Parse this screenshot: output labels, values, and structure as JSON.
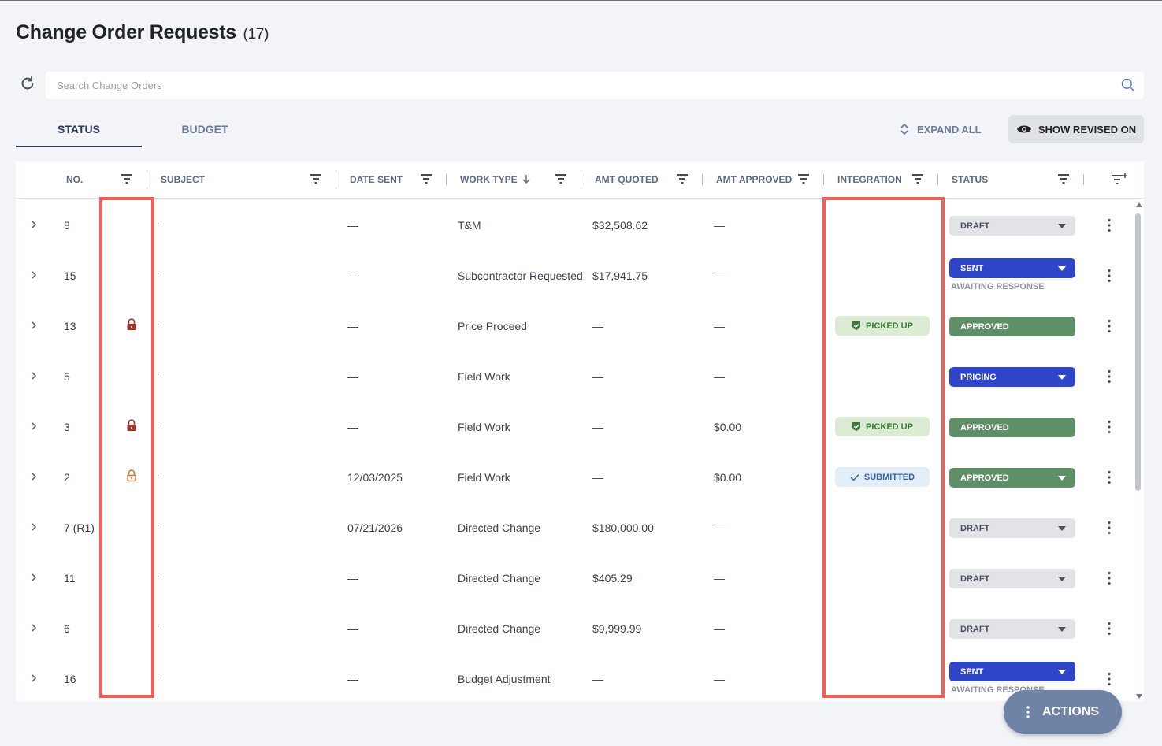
{
  "page": {
    "title": "Change Order Requests",
    "count": "(17)"
  },
  "search": {
    "placeholder": "Search Change Orders"
  },
  "tabs": [
    {
      "label": "STATUS",
      "active": true
    },
    {
      "label": "BUDGET",
      "active": false
    }
  ],
  "toolbar": {
    "expand_all": "EXPAND ALL",
    "show_revised": "SHOW REVISED ON"
  },
  "columns": {
    "no": "NO.",
    "subject": "SUBJECT",
    "date_sent": "DATE SENT",
    "work_type": "WORK TYPE",
    "amt_quoted": "AMT QUOTED",
    "amt_approved": "AMT APPROVED",
    "integration": "INTEGRATION",
    "status": "STATUS"
  },
  "rows": [
    {
      "no": "8",
      "lock": "",
      "date_sent": "—",
      "work_type": "T&M",
      "amt_quoted": "$32,508.62",
      "amt_approved": "—",
      "integration": "",
      "status": "DRAFT",
      "status_sub": ""
    },
    {
      "no": "15",
      "lock": "",
      "date_sent": "—",
      "work_type": "Subcontractor Requested",
      "amt_quoted": "$17,941.75",
      "amt_approved": "—",
      "integration": "",
      "status": "SENT",
      "status_sub": "AWAITING RESPONSE"
    },
    {
      "no": "13",
      "lock": "locked",
      "date_sent": "—",
      "work_type": "Price Proceed",
      "amt_quoted": "—",
      "amt_approved": "—",
      "integration": "PICKED UP",
      "status": "APPROVED",
      "status_sub": ""
    },
    {
      "no": "5",
      "lock": "",
      "date_sent": "—",
      "work_type": "Field Work",
      "amt_quoted": "—",
      "amt_approved": "—",
      "integration": "",
      "status": "PRICING",
      "status_sub": ""
    },
    {
      "no": "3",
      "lock": "locked",
      "date_sent": "—",
      "work_type": "Field Work",
      "amt_quoted": "—",
      "amt_approved": "$0.00",
      "integration": "PICKED UP",
      "status": "APPROVED",
      "status_sub": ""
    },
    {
      "no": "2",
      "lock": "unlocked",
      "date_sent": "12/03/2025",
      "work_type": "Field Work",
      "amt_quoted": "—",
      "amt_approved": "$0.00",
      "integration": "SUBMITTED",
      "status": "APPROVED",
      "status_sub": ""
    },
    {
      "no": "7 (R1)",
      "lock": "",
      "date_sent": "07/21/2026",
      "work_type": "Directed Change",
      "amt_quoted": "$180,000.00",
      "amt_approved": "—",
      "integration": "",
      "status": "DRAFT",
      "status_sub": ""
    },
    {
      "no": "11",
      "lock": "",
      "date_sent": "—",
      "work_type": "Directed Change",
      "amt_quoted": "$405.29",
      "amt_approved": "—",
      "integration": "",
      "status": "DRAFT",
      "status_sub": ""
    },
    {
      "no": "6",
      "lock": "",
      "date_sent": "—",
      "work_type": "Directed Change",
      "amt_quoted": "$9,999.99",
      "amt_approved": "—",
      "integration": "",
      "status": "DRAFT",
      "status_sub": ""
    },
    {
      "no": "16",
      "lock": "",
      "date_sent": "—",
      "work_type": "Budget Adjustment",
      "amt_quoted": "—",
      "amt_approved": "—",
      "integration": "",
      "status": "SENT",
      "status_sub": "AWAITING RESPONSE"
    }
  ],
  "fab": {
    "label": "ACTIONS"
  },
  "colors": {
    "sent": "#2e45c7",
    "approved": "#5f8f66",
    "draft": "#e1e3e7",
    "highlight": "#f2605a",
    "lock_locked": "#a5352b",
    "lock_unlocked": "#d07a2a"
  }
}
